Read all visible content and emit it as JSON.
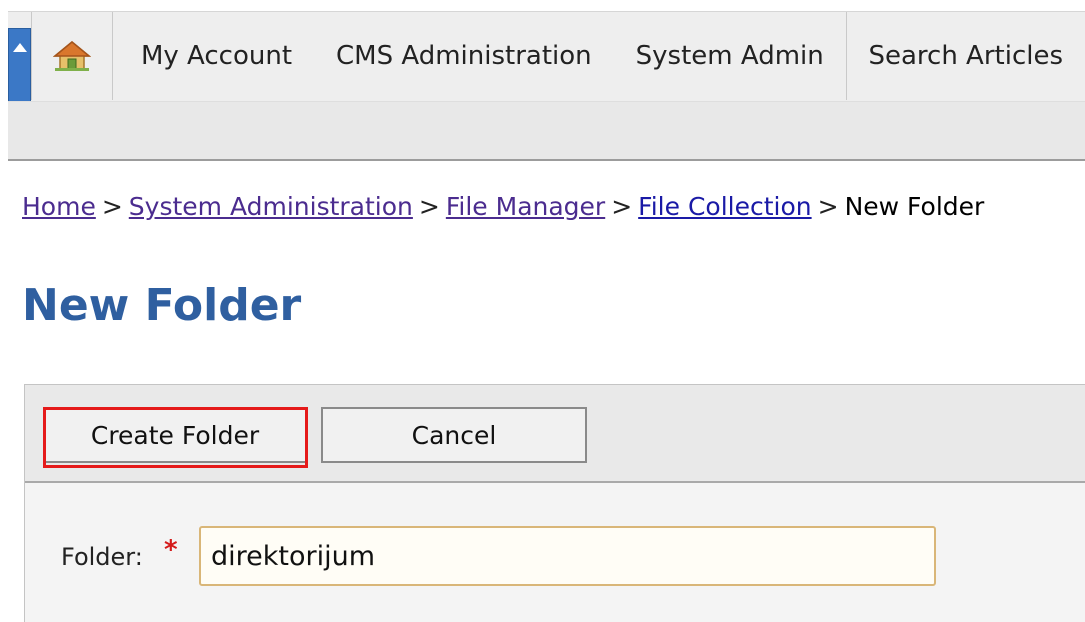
{
  "nav": {
    "items": [
      {
        "label": "My Account"
      },
      {
        "label": "CMS Administration"
      },
      {
        "label": "System Admin"
      },
      {
        "label": "Search Articles"
      }
    ]
  },
  "breadcrumb": {
    "items": [
      {
        "label": "Home"
      },
      {
        "label": "System Administration"
      },
      {
        "label": "File Manager"
      },
      {
        "label": "File Collection"
      }
    ],
    "current": "New Folder",
    "separator": ">"
  },
  "page": {
    "title": "New Folder"
  },
  "toolbar": {
    "create_label": "Create Folder",
    "cancel_label": "Cancel"
  },
  "form": {
    "folder_label": "Folder:",
    "required_mark": "*",
    "folder_value": "direktorijum"
  },
  "colors": {
    "title": "#2f5fa0",
    "link_visited": "#4b2c8f",
    "link_unvisited": "#1a1aa6",
    "highlight": "#e51a1a",
    "nav_scroll": "#3b78c6"
  },
  "icons": {
    "nav_scroll": "up-arrow-icon",
    "home": "home-icon"
  }
}
